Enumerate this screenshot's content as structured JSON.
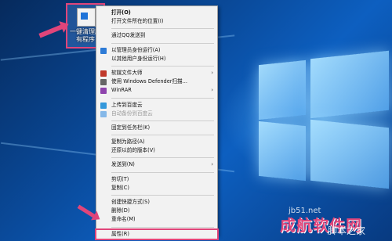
{
  "desktop_icon": {
    "label": "一键清理所有程序"
  },
  "menu": {
    "items": [
      {
        "label": "打开(O)",
        "bold": true
      },
      {
        "label": "打开文件所在的位置(I)"
      },
      {
        "sep": true
      },
      {
        "label": "通过QQ发送到"
      },
      {
        "sep": true
      },
      {
        "label": "以管理员身份运行(A)",
        "icon": "shield-icon",
        "color": "#2d7bd6"
      },
      {
        "label": "以其他用户身份运行(H)"
      },
      {
        "sep": true
      },
      {
        "label": "软媒文件大师",
        "icon": "app-icon",
        "color": "#c0392b",
        "sub": true
      },
      {
        "label": "使用 Windows Defender扫描...",
        "icon": "defender-icon",
        "color": "#666666"
      },
      {
        "label": "WinRAR",
        "icon": "winrar-icon",
        "color": "#8e44ad",
        "sub": true
      },
      {
        "sep": true
      },
      {
        "label": "上传到百度云",
        "icon": "cloud-icon",
        "color": "#3498db"
      },
      {
        "label": "自动备份到百度云",
        "icon": "cloud-icon",
        "color": "#85b8e8",
        "disabled": true
      },
      {
        "sep": true
      },
      {
        "label": "固定到任务栏(K)"
      },
      {
        "sep": true
      },
      {
        "label": "复制为路径(A)"
      },
      {
        "label": "还原以前的版本(V)"
      },
      {
        "sep": true
      },
      {
        "label": "发送到(N)",
        "sub": true
      },
      {
        "sep": true
      },
      {
        "label": "剪切(T)"
      },
      {
        "label": "复制(C)"
      },
      {
        "sep": true
      },
      {
        "label": "创建快捷方式(S)"
      },
      {
        "label": "删除(D)"
      },
      {
        "label": "重命名(M)"
      },
      {
        "sep": true
      },
      {
        "label": "属性(R)",
        "highlight": true
      }
    ]
  },
  "watermark": {
    "main": "脚本之家",
    "top": "jb51.net",
    "pink": "成航软件网"
  },
  "colors": {
    "accent": "#e0457a",
    "menu_bg": "#f2f2f2"
  }
}
